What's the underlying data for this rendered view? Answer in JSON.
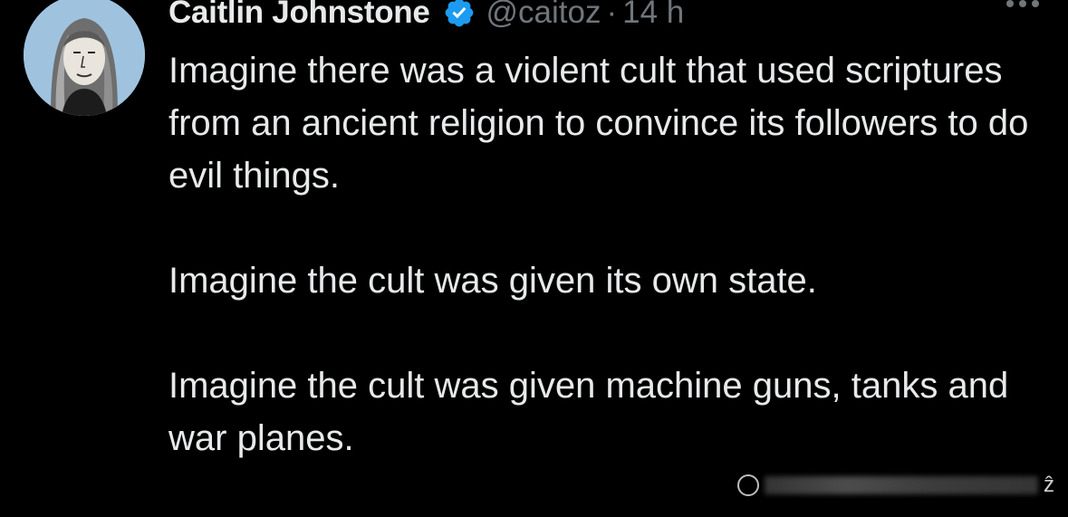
{
  "tweet": {
    "display_name": "Caitlin Johnstone",
    "handle": "@caitoz",
    "separator": "·",
    "time": "14 h",
    "paragraphs": [
      "Imagine there was a violent cult that used scriptures from an ancient religion to convince its followers to do evil things.",
      "Imagine the cult was given its own state.",
      "Imagine the cult was given machine guns, tanks and war planes."
    ]
  },
  "watermark": {
    "mark": "ẑ"
  },
  "colors": {
    "background": "#000000",
    "text_primary": "#e7e9ea",
    "text_secondary": "#71767b",
    "verified_badge": "#1d9bf0"
  },
  "icons": {
    "verified": "verified-badge-icon",
    "more": "more-horizontal-icon"
  }
}
